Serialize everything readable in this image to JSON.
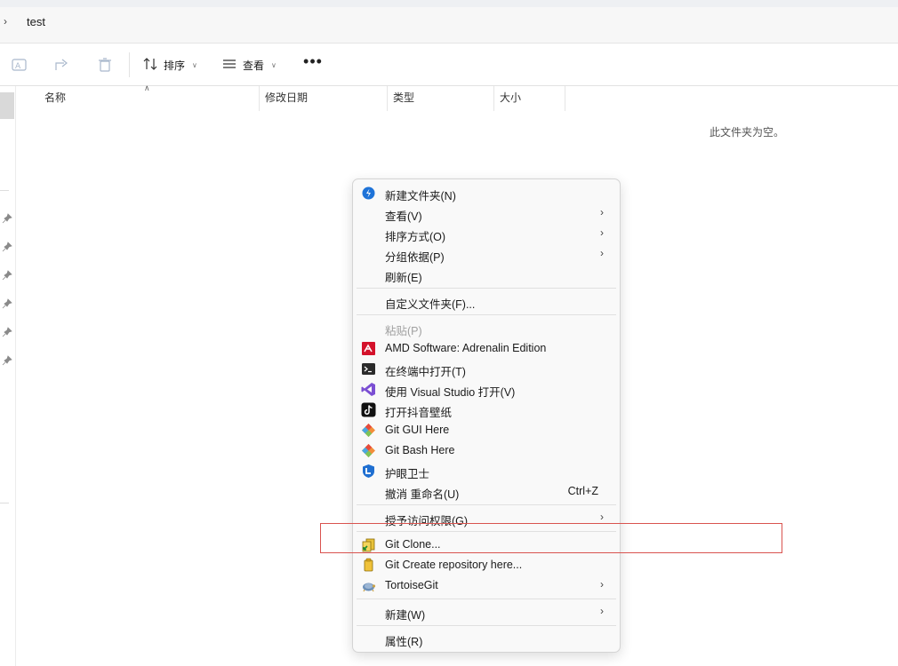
{
  "address": {
    "path": "test"
  },
  "toolbar": {
    "sort_label": "排序",
    "view_label": "查看"
  },
  "columns": [
    "名称",
    "修改日期",
    "类型",
    "大小"
  ],
  "empty_message": "此文件夹为空。",
  "context_menu": {
    "items": [
      {
        "label": "新建文件夹(N)",
        "icon": "new-folder-icon"
      },
      {
        "label": "查看(V)",
        "submenu": true
      },
      {
        "label": "排序方式(O)",
        "submenu": true
      },
      {
        "label": "分组依据(P)",
        "submenu": true
      },
      {
        "label": "刷新(E)"
      },
      {
        "label": "自定义文件夹(F)..."
      },
      {
        "label": "粘贴(P)",
        "disabled": true
      },
      {
        "label": "AMD Software: Adrenalin Edition",
        "icon": "amd-icon"
      },
      {
        "label": "在终端中打开(T)",
        "icon": "terminal-icon"
      },
      {
        "label": "使用 Visual Studio 打开(V)",
        "icon": "visual-studio-icon"
      },
      {
        "label": "打开抖音壁纸",
        "icon": "douyin-icon"
      },
      {
        "label": "Git GUI Here",
        "icon": "git-gui-icon"
      },
      {
        "label": "Git Bash Here",
        "icon": "git-bash-icon"
      },
      {
        "label": "护眼卫士",
        "icon": "eye-guard-icon"
      },
      {
        "label": "撤消 重命名(U)",
        "shortcut": "Ctrl+Z"
      },
      {
        "label": "授予访问权限(G)",
        "submenu": true
      },
      {
        "label": "Git Clone...",
        "icon": "git-clone-icon"
      },
      {
        "label": "Git Create repository here...",
        "icon": "git-create-repo-icon"
      },
      {
        "label": "TortoiseGit",
        "icon": "tortoisegit-icon",
        "submenu": true
      },
      {
        "label": "新建(W)",
        "submenu": true
      },
      {
        "label": "属性(R)"
      }
    ]
  },
  "colors": {
    "highlight_box": "#d9534f",
    "menu_bg": "#f9f9f9"
  }
}
